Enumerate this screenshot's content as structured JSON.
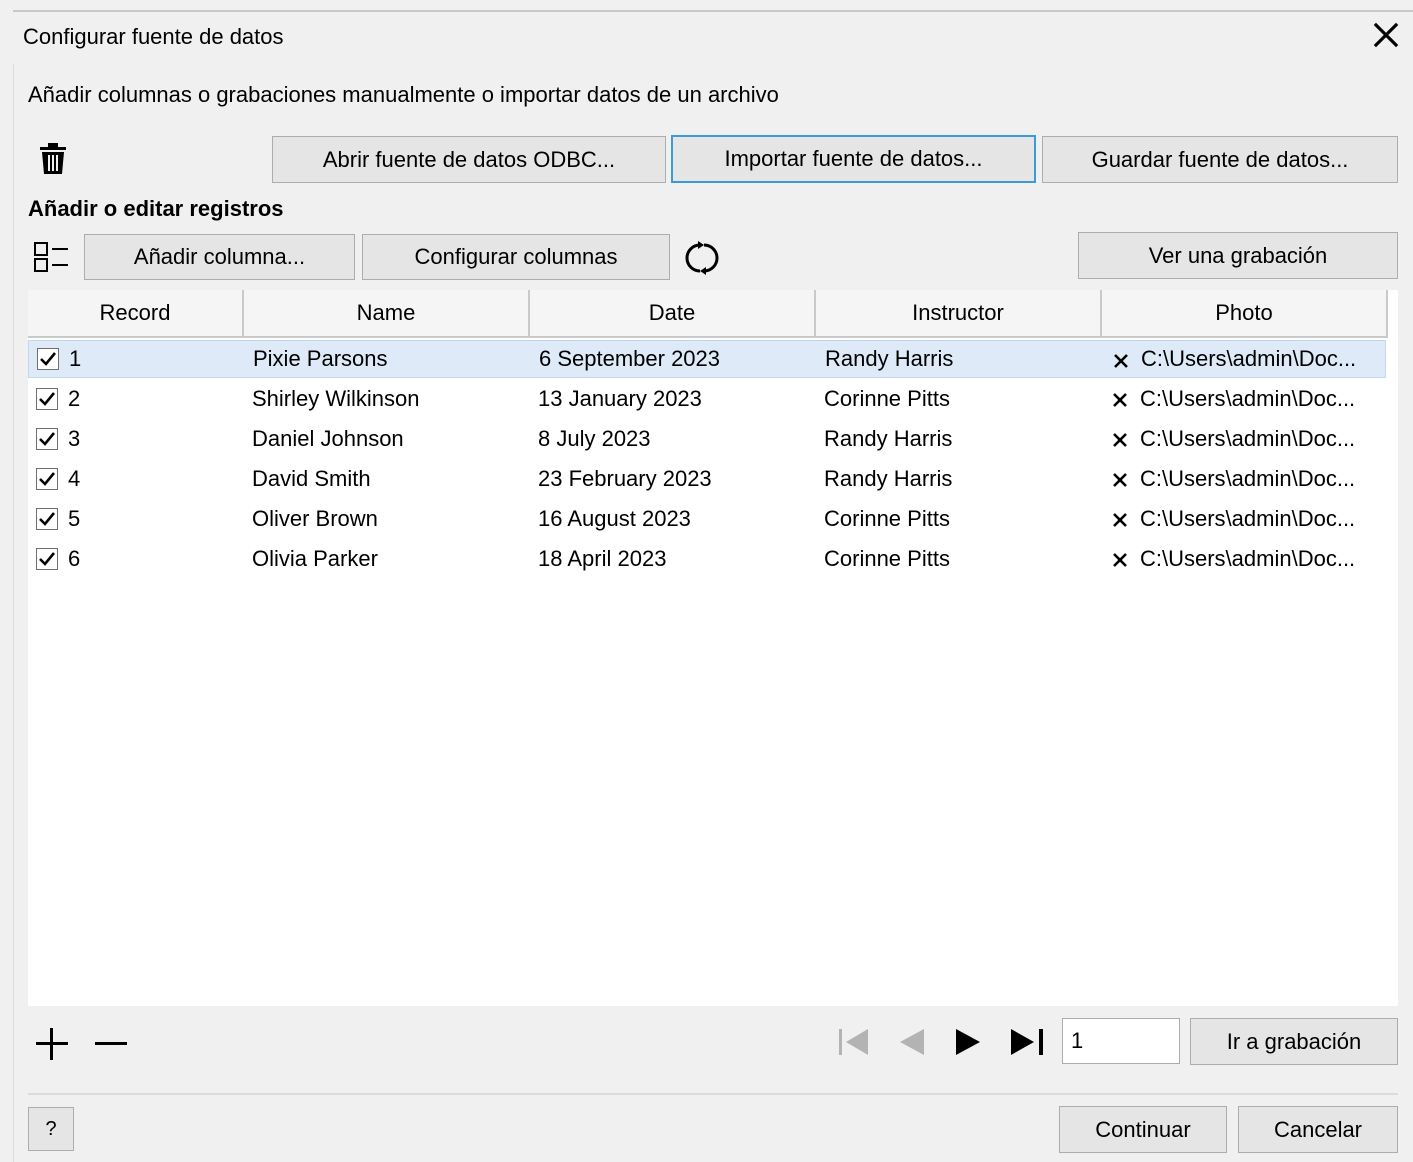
{
  "window": {
    "title": "Configurar fuente de datos",
    "close_icon": "close-icon"
  },
  "instructions": "Añadir columnas o grabaciones manualmente o importar datos de un archivo",
  "toolbar": {
    "delete_icon": "trash-icon",
    "open_odbc": "Abrir fuente de datos ODBC...",
    "import": "Importar fuente de datos...",
    "save": "Guardar fuente de datos..."
  },
  "records_section": {
    "label": "Añadir o editar registros",
    "columns_icon": "column-list-icon",
    "add_column": "Añadir columna...",
    "configure_columns": "Configurar columnas",
    "refresh_icon": "refresh-icon",
    "view_record": "Ver una grabación"
  },
  "grid": {
    "columns": [
      "Record",
      "Name",
      "Date",
      "Instructor",
      "Photo"
    ],
    "rows": [
      {
        "record": "1",
        "checked": true,
        "name": "Pixie Parsons",
        "date": "6 September 2023",
        "instructor": "Randy Harris",
        "photo": "C:\\Users\\admin\\Doc...",
        "selected": true
      },
      {
        "record": "2",
        "checked": true,
        "name": "Shirley Wilkinson",
        "date": "13 January 2023",
        "instructor": "Corinne Pitts",
        "photo": "C:\\Users\\admin\\Doc...",
        "selected": false
      },
      {
        "record": "3",
        "checked": true,
        "name": "Daniel Johnson",
        "date": "8 July 2023",
        "instructor": "Randy Harris",
        "photo": "C:\\Users\\admin\\Doc...",
        "selected": false
      },
      {
        "record": "4",
        "checked": true,
        "name": "David Smith",
        "date": "23 February 2023",
        "instructor": "Randy Harris",
        "photo": "C:\\Users\\admin\\Doc...",
        "selected": false
      },
      {
        "record": "5",
        "checked": true,
        "name": "Oliver Brown",
        "date": "16 August 2023",
        "instructor": "Corinne Pitts",
        "photo": "C:\\Users\\admin\\Doc...",
        "selected": false
      },
      {
        "record": "6",
        "checked": true,
        "name": "Olivia Parker",
        "date": "18 April 2023",
        "instructor": "Corinne Pitts",
        "photo": "C:\\Users\\admin\\Doc...",
        "selected": false
      }
    ],
    "photo_status_icon": "x-mark-icon"
  },
  "navigation": {
    "add_icon": "plus-icon",
    "remove_icon": "minus-icon",
    "first_icon": "first-record-icon",
    "prev_icon": "previous-record-icon",
    "next_icon": "next-record-icon",
    "last_icon": "last-record-icon",
    "record_value": "1",
    "go_to_record": "Ir a grabación"
  },
  "footer": {
    "help": "?",
    "continue": "Continuar",
    "cancel": "Cancelar"
  },
  "colors": {
    "background": "#f0f0f0",
    "selected_row": "#deeaf7",
    "focus_border": "#3c9ad8",
    "button_bg": "#e5e5e5"
  }
}
